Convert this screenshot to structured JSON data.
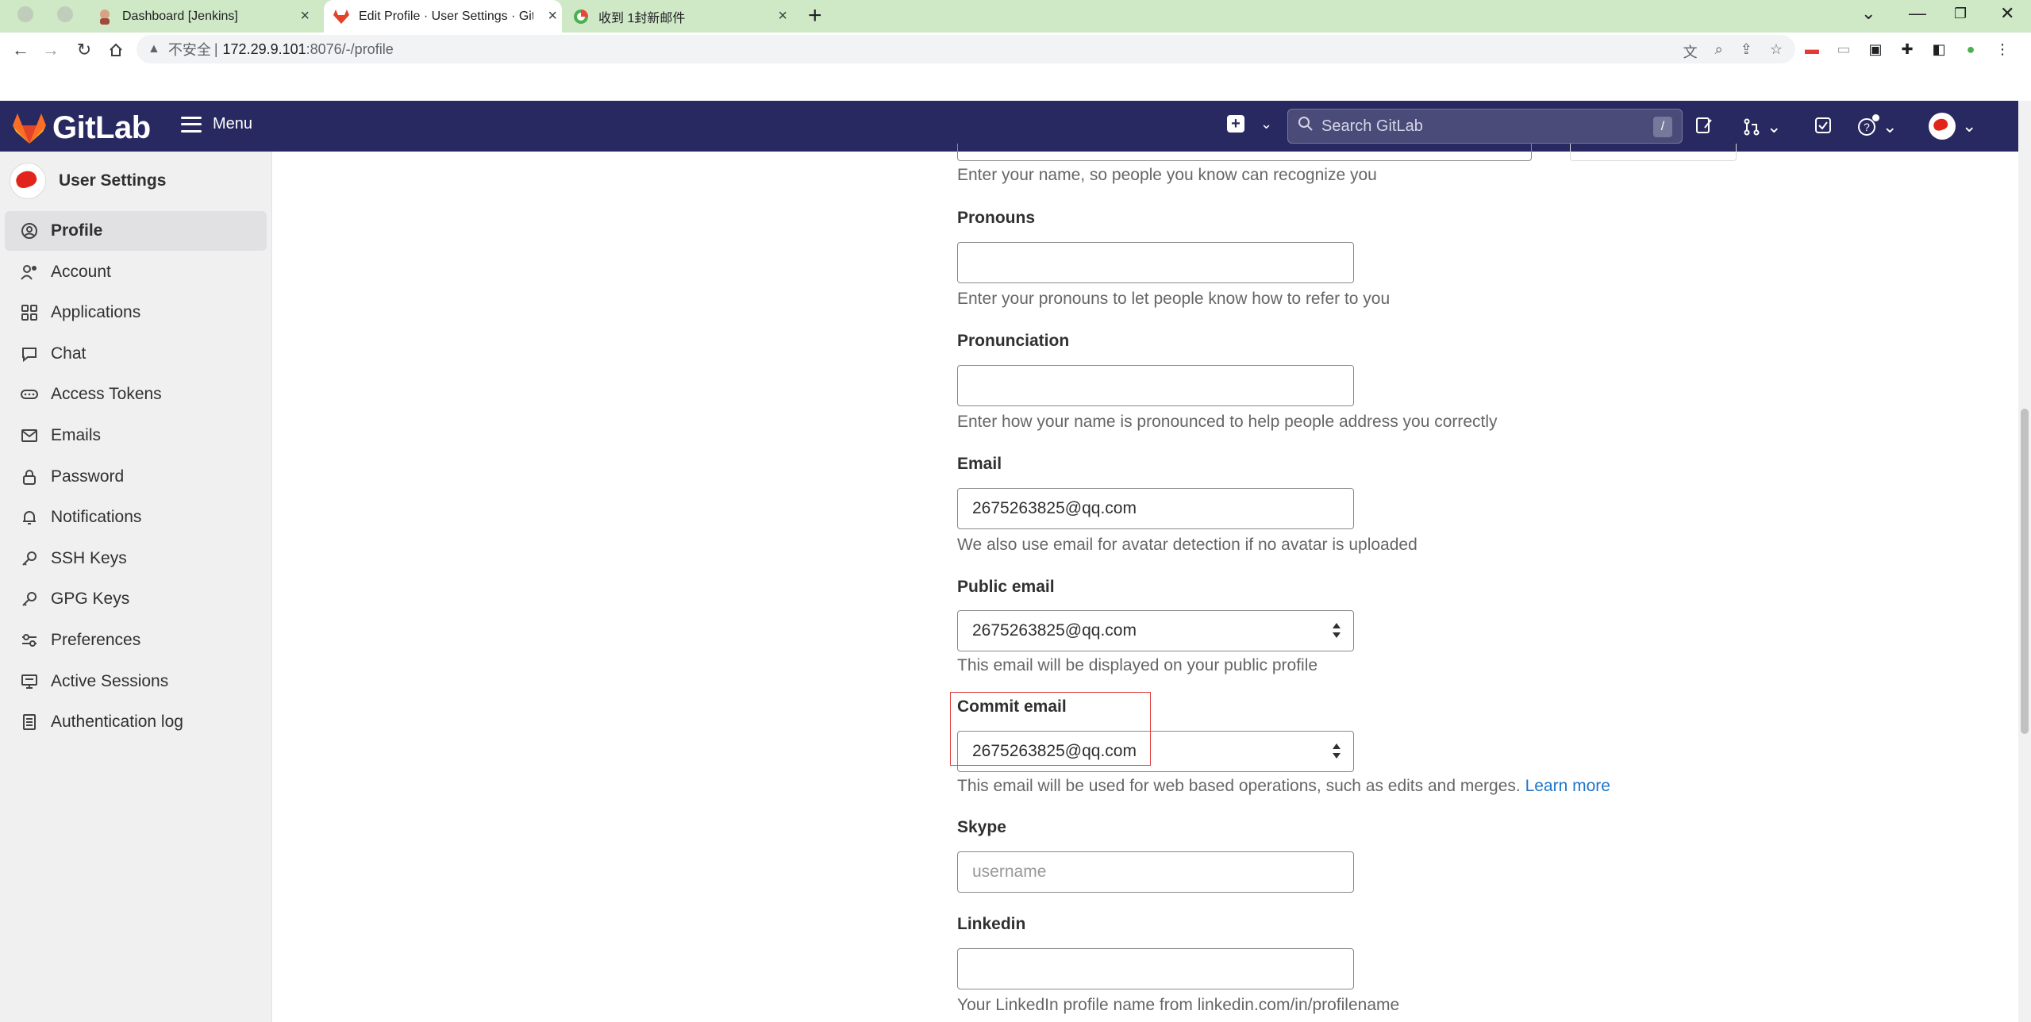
{
  "browser": {
    "tabs": [
      {
        "title": "Dashboard [Jenkins]",
        "active": false
      },
      {
        "title": "Edit Profile · User Settings · Git",
        "active": true
      },
      {
        "title": "收到 1封新邮件",
        "active": false
      }
    ],
    "new_tab": "+",
    "address": {
      "security_label": "不安全",
      "host": "172.29.9.101",
      "path": ":8076/-/profile"
    }
  },
  "gitlab": {
    "brand": "GitLab",
    "menu_label": "Menu",
    "search_placeholder": "Search GitLab",
    "search_shortcut": "/"
  },
  "sidebar": {
    "title": "User Settings",
    "items": [
      {
        "label": "Profile",
        "icon": "profile-icon",
        "active": true
      },
      {
        "label": "Account",
        "icon": "account-icon"
      },
      {
        "label": "Applications",
        "icon": "applications-icon"
      },
      {
        "label": "Chat",
        "icon": "chat-icon"
      },
      {
        "label": "Access Tokens",
        "icon": "token-icon"
      },
      {
        "label": "Emails",
        "icon": "mail-icon"
      },
      {
        "label": "Password",
        "icon": "lock-icon"
      },
      {
        "label": "Notifications",
        "icon": "bell-icon"
      },
      {
        "label": "SSH Keys",
        "icon": "key-icon"
      },
      {
        "label": "GPG Keys",
        "icon": "key-icon"
      },
      {
        "label": "Preferences",
        "icon": "preferences-icon"
      },
      {
        "label": "Active Sessions",
        "icon": "monitor-icon"
      },
      {
        "label": "Authentication log",
        "icon": "log-icon"
      }
    ]
  },
  "form": {
    "name_help": "Enter your name, so people you know can recognize you",
    "pronouns": {
      "label": "Pronouns",
      "value": "",
      "help": "Enter your pronouns to let people know how to refer to you"
    },
    "pronunciation": {
      "label": "Pronunciation",
      "value": "",
      "help": "Enter how your name is pronounced to help people address you correctly"
    },
    "email": {
      "label": "Email",
      "value": "2675263825@qq.com",
      "help": "We also use email for avatar detection if no avatar is uploaded"
    },
    "public_email": {
      "label": "Public email",
      "value": "2675263825@qq.com",
      "help": "This email will be displayed on your public profile"
    },
    "commit_email": {
      "label": "Commit email",
      "value": "2675263825@qq.com",
      "help": "This email will be used for web based operations, such as edits and merges.",
      "link": "Learn more"
    },
    "skype": {
      "label": "Skype",
      "placeholder": "username"
    },
    "linkedin": {
      "label": "Linkedin",
      "value": "",
      "help": "Your LinkedIn profile name from linkedin.com/in/profilename"
    }
  },
  "colors": {
    "gitlab_header": "#292961",
    "browser_tabbar": "#cfe8c6",
    "highlight": "#e03c3c",
    "link": "#1f75cb"
  }
}
